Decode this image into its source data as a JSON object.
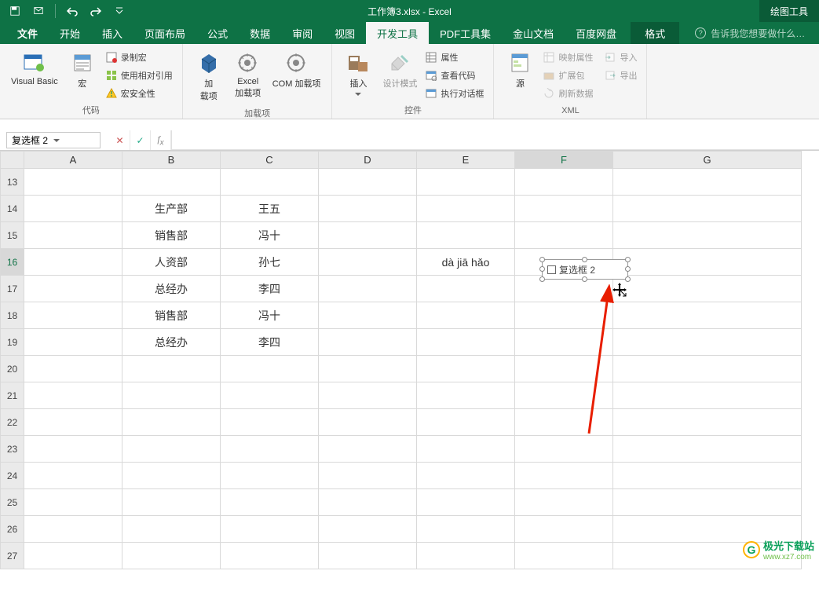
{
  "title": {
    "doc": "工作簿3.xlsx",
    "app": "Excel",
    "sep": " - "
  },
  "qat": {
    "save": "save-icon",
    "save2": "save-mail-icon",
    "undo": "undo-icon",
    "redo": "redo-icon",
    "customize": "▾"
  },
  "toolTab": "绘图工具",
  "tabs": {
    "file": "文件",
    "home": "开始",
    "insert": "插入",
    "layout": "页面布局",
    "formula": "公式",
    "data": "数据",
    "review": "审阅",
    "view": "视图",
    "devtools": "开发工具",
    "pdf": "PDF工具集",
    "jsdoc": "金山文档",
    "baidu": "百度网盘",
    "format": "格式",
    "tellme": "告诉我您想要做什么…"
  },
  "ribbon": {
    "code": {
      "label": "代码",
      "vb": "Visual Basic",
      "macro": "宏",
      "record": "录制宏",
      "relref": "使用相对引用",
      "security": "宏安全性"
    },
    "addin": {
      "label": "加载项",
      "addin": "加\n载项",
      "excel": "Excel\n加载项",
      "com": "COM 加载项"
    },
    "controls": {
      "label": "控件",
      "insert": "插入",
      "design": "设计模式",
      "props": "属性",
      "viewcode": "查看代码",
      "rundialog": "执行对话框"
    },
    "xml": {
      "label": "XML",
      "source": "源",
      "mapprops": "映射属性",
      "expand": "扩展包",
      "refresh": "刷新数据",
      "import": "导入",
      "export": "导出"
    }
  },
  "namebox": "复选框 2",
  "formula": "",
  "columns": [
    "A",
    "B",
    "C",
    "D",
    "E",
    "F",
    "G"
  ],
  "rows": [
    "13",
    "14",
    "15",
    "16",
    "17",
    "18",
    "19",
    "20",
    "21",
    "22",
    "23",
    "24",
    "25",
    "26",
    "27"
  ],
  "cells": {
    "B14": "生产部",
    "C14": "王五",
    "B15": "销售部",
    "C15": "冯十",
    "B16": "人资部",
    "C16": "孙七",
    "E16": "dà jiā hǎo",
    "B17": "总经办",
    "C17": "李四",
    "B18": "销售部",
    "C18": "冯十",
    "B19": "总经办",
    "C19": "李四"
  },
  "checkboxLabel": "复选框 2",
  "watermark": {
    "brand": "极光下载站",
    "url": "www.xz7.com",
    "logoLetter": "G"
  }
}
